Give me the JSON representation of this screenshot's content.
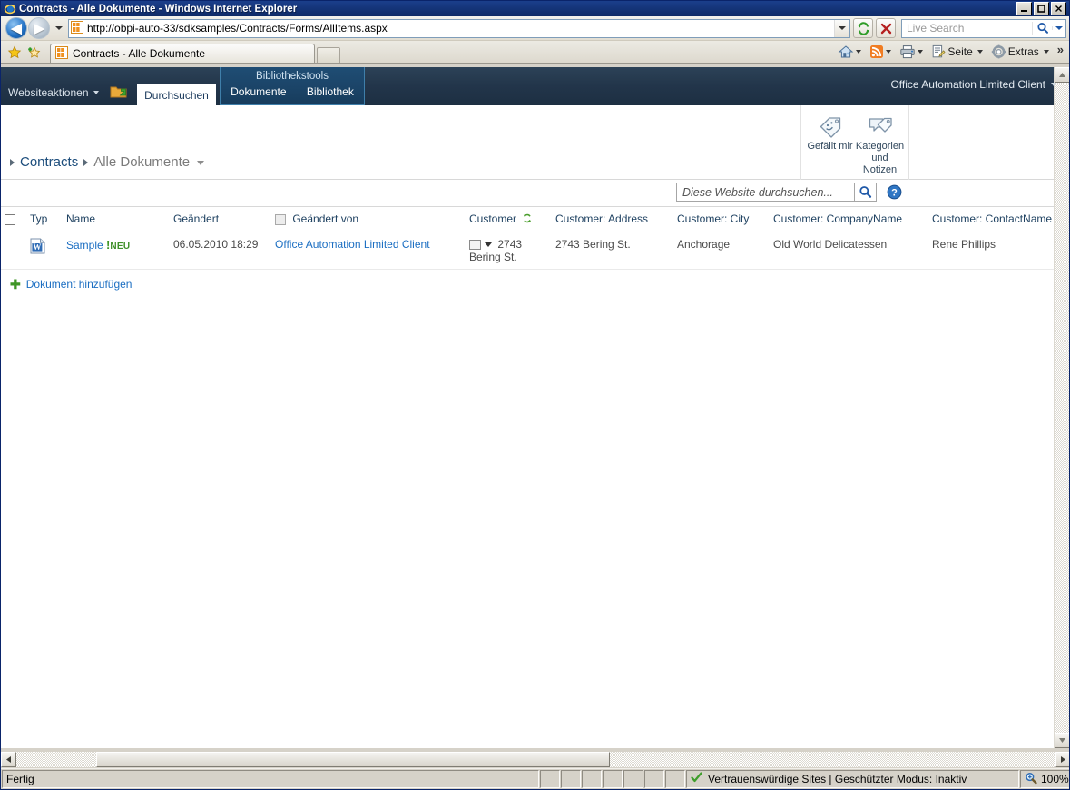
{
  "window": {
    "title": "Contracts - Alle Dokumente - Windows Internet Explorer",
    "minimize_label": "Minimieren",
    "maximize_label": "Maximieren",
    "close_label": "Schließen"
  },
  "browser": {
    "back_label": "Zurück",
    "forward_label": "Vorwärts",
    "history_label": "Letzte Seiten",
    "url": "http://obpi-auto-33/sdksamples/Contracts/Forms/AllItems.aspx",
    "url_dropdown_label": "Adressliste",
    "refresh_label": "Aktualisieren",
    "stop_label": "Abbrechen",
    "search_placeholder": "Live Search",
    "search_value": "",
    "search_go_label": "Suchen",
    "search_provider_label": "Suchanbieter",
    "favorites_label": "Favoriten",
    "add_favorites_label": "Zu Favoriten hinzufügen",
    "tab_title": "Contracts - Alle Dokumente",
    "new_tab_label": "Neue Registerkarte",
    "commands": {
      "home": "Startseite",
      "feeds": "Feeds",
      "print": "Drucken",
      "page": "Seite",
      "tools": "Extras",
      "more": "»"
    }
  },
  "sharepoint": {
    "site_actions": "Websiteaktionen",
    "navigate_up_label": "Nach oben navigieren",
    "browse_tab": "Durchsuchen",
    "contextual_group_title": "Bibliothekstools",
    "contextual_tabs": [
      {
        "label": "Dokumente"
      },
      {
        "label": "Bibliothek"
      }
    ],
    "user_name": "Office Automation Limited Client",
    "ribbon_buttons": [
      {
        "label": "Gefällt mir",
        "icon": "tag-smiley-icon"
      },
      {
        "label": "Kategorien und Notizen",
        "icon": "note-tag-icon"
      }
    ],
    "breadcrumb": {
      "site": "Contracts",
      "view": "Alle Dokumente"
    },
    "search": {
      "placeholder": "Diese Website durchsuchen...",
      "value": "",
      "go_label": "Suchen",
      "help_label": "Hilfe"
    }
  },
  "listview": {
    "select_all_label": "Alle auswählen",
    "columns": [
      {
        "key": "type",
        "label": "Typ"
      },
      {
        "key": "name",
        "label": "Name"
      },
      {
        "key": "modified",
        "label": "Geändert"
      },
      {
        "key": "modified_by",
        "label": "Geändert von"
      },
      {
        "key": "customer",
        "label": "Customer",
        "sorted": true
      },
      {
        "key": "address",
        "label": "Customer: Address"
      },
      {
        "key": "city",
        "label": "Customer: City"
      },
      {
        "key": "company",
        "label": "Customer: CompanyName"
      },
      {
        "key": "contact",
        "label": "Customer: ContactName"
      }
    ],
    "rows": [
      {
        "type_icon": "word-document-icon",
        "name": "Sample",
        "new_badge": "NEU",
        "modified": "06.05.2010 18:29",
        "modified_by": "Office Automation Limited Client",
        "customer": "2743 Bering St.",
        "address": "2743 Bering St.",
        "city": "Anchorage",
        "company": "Old World Delicatessen",
        "contact": "Rene Phillips"
      }
    ],
    "add_document": "Dokument hinzufügen"
  },
  "statusbar": {
    "status": "Fertig",
    "zone": "Vertrauenswürdige Sites | Geschützter Modus: Inaktiv",
    "zoom": "100%",
    "zoom_dropdown_label": "Zoomstufe ändern"
  }
}
